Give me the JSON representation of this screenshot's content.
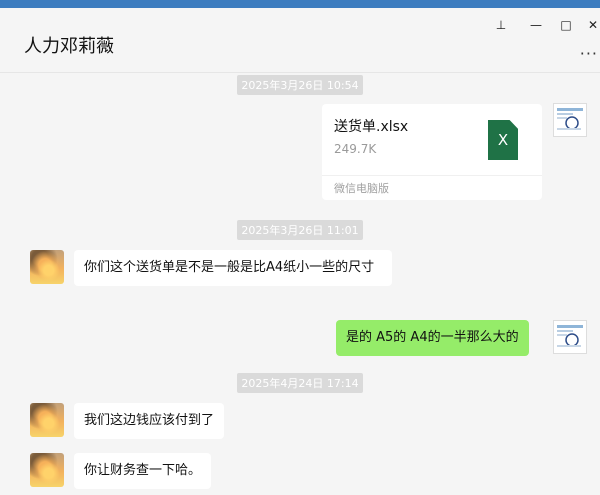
{
  "chat": {
    "title": "人力邓莉薇"
  },
  "window_controls": {
    "pin": "⊥",
    "minimize": "—",
    "maximize": "□",
    "close": "✕",
    "more": "···"
  },
  "messages": {
    "ts1": "2025年3月26日 10:54",
    "file": {
      "name": "送货单.xlsx",
      "size": "249.7K",
      "source": "微信电脑版",
      "icon_text": "X"
    },
    "ts2": "2025年3月26日 11:01",
    "in1": "你们这个送货单是不是一般是比A4纸小一些的尺寸",
    "out1": "是的 A5的 A4的一半那么大的",
    "ts3": "2025年4月24日 17:14",
    "in2": "我们这边钱应该付到了",
    "in3": "你让财务查一下哈。"
  },
  "colors": {
    "accent_bar": "#3c7cbf",
    "outgoing_bubble": "#95ec69",
    "excel_green": "#1f7246"
  }
}
